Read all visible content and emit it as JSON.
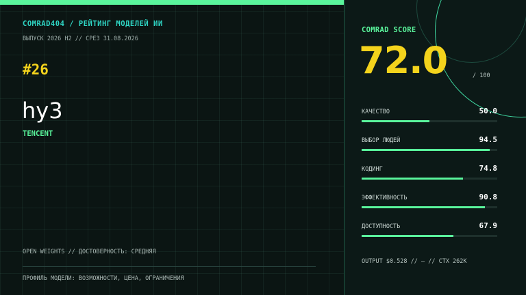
{
  "header": {
    "brand": "COMRAD404 / РЕЙТИНГ МОДЕЛЕЙ ИИ",
    "issue": "ВЫПУСК 2026 H2  //  СРЕЗ 31.08.2026"
  },
  "model": {
    "rank": "#26",
    "name": "hy3",
    "vendor": "TENCENT",
    "tags": "OPEN WEIGHTS  //  ДОСТОВЕРНОСТЬ: СРЕДНЯЯ",
    "profile": "ПРОФИЛЬ МОДЕЛИ: ВОЗМОЖНОСТИ, ЦЕНА, ОГРАНИЧЕНИЯ"
  },
  "score": {
    "label": "COMRAD SCORE",
    "value": "72.0",
    "max": "/ 100"
  },
  "metrics": [
    {
      "name": "КАЧЕСТВО",
      "value": "50.0",
      "level": 50.0
    },
    {
      "name": "ВЫБОР ЛЮДЕЙ",
      "value": "94.5",
      "level": 94.5
    },
    {
      "name": "КОДИНГ",
      "value": "74.8",
      "level": 74.8
    },
    {
      "name": "ЭФФЕКТИВНОСТЬ",
      "value": "90.8",
      "level": 90.8
    },
    {
      "name": "ДОСТУПНОСТЬ",
      "value": "67.9",
      "level": 67.9
    }
  ],
  "footer": "OUTPUT $0.528  //  —  //  CTX 262K",
  "colors": {
    "accent_green": "#5af59c",
    "accent_cyan": "#2fd6c5",
    "accent_yellow": "#f4d31c",
    "background": "#0b1513"
  }
}
